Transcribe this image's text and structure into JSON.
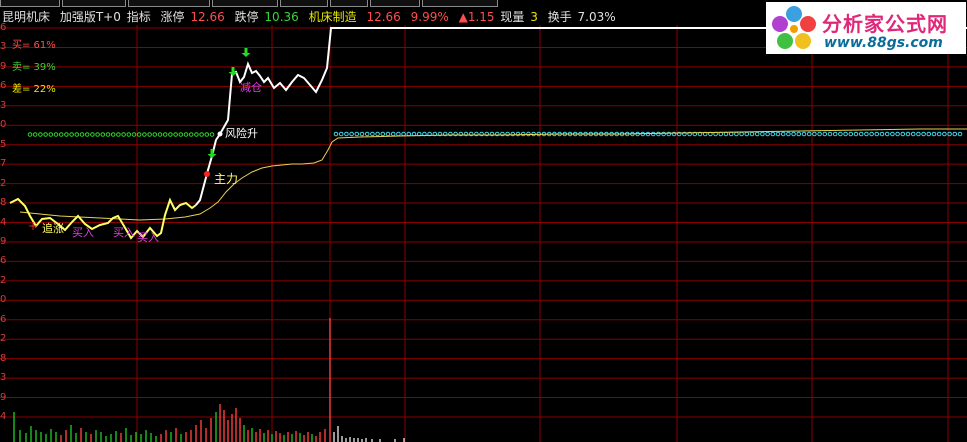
{
  "tabs": [
    "",
    "",
    "",
    "",
    "",
    "",
    "",
    "",
    "",
    ""
  ],
  "info": {
    "stock_name": "昆明机床",
    "indicator_name": "加强版T+0",
    "indicator_label": "指标",
    "limit_up_label": "涨停",
    "limit_up_value": "12.66",
    "limit_down_label": "跌停",
    "limit_down_value": "10.36",
    "sector_name": "机床制造",
    "price": "12.66",
    "pct_change": "9.99%",
    "change": "▲1.15",
    "volume_label": "现量",
    "volume_value": "3",
    "turnover_label": "换手",
    "turnover_value": "7.03%"
  },
  "stats": {
    "buy_label": "买= 61%",
    "sell_label": "卖= 39%",
    "diff_label": "差= 22%"
  },
  "y_axis_labels": [
    "6",
    "3",
    "9",
    "6",
    "3",
    "0",
    "5",
    "7",
    "2",
    "8",
    "4",
    "9",
    "6",
    "2",
    "0",
    "6",
    "2",
    "8",
    "3",
    "9",
    "4"
  ],
  "annotations": {
    "chase_up": "追涨",
    "buy1": "买入",
    "buy2": "买入",
    "buy3": "买入",
    "main_force": "主力",
    "risk_up": "风险升",
    "reduce": "减仓"
  },
  "logo": {
    "name": "分析家公式网",
    "url": "www.88gs.com"
  },
  "colors": {
    "grid": "#8b0000",
    "price_line": "#ffffff",
    "price_line_low": "#ffff66",
    "avg_line": "#e8d250",
    "dot_green": "#2fd62f",
    "dot_cyan": "#40d8e8",
    "vol_green": "#1fbf1f",
    "vol_red": "#ff4040",
    "vol_white": "#dddddd",
    "magenta": "#e040e0",
    "signal_green": "#22dd22",
    "signal_red": "#ff2020"
  }
}
